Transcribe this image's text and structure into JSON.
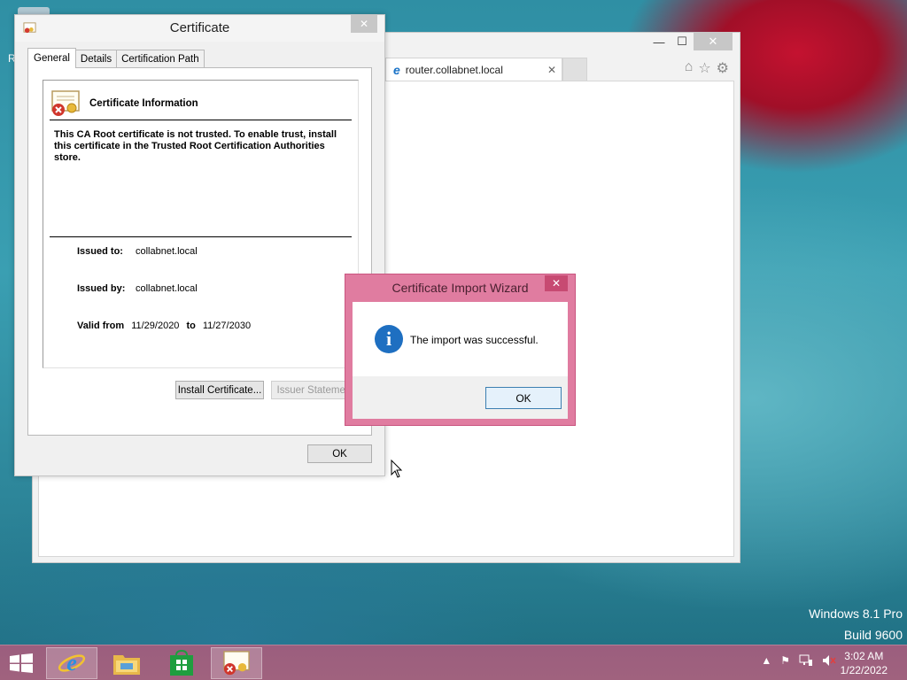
{
  "browser": {
    "tab_title": "router.collabnet.local",
    "tab_close": "✕",
    "icons": [
      "home-icon",
      "favorites-star-icon",
      "settings-gear-icon"
    ],
    "caption_min": "—",
    "caption_max": "☐",
    "caption_close": "✕"
  },
  "certificate_dialog": {
    "title": "Certificate",
    "close_glyph": "✕",
    "tabs": [
      "General",
      "Details",
      "Certification Path"
    ],
    "active_tab": "General",
    "heading": "Certificate Information",
    "warning": "This CA Root certificate is not trusted. To enable trust, install this certificate in the Trusted Root Certification Authorities store.",
    "issued_to_label": "Issued to:",
    "issued_to": "collabnet.local",
    "issued_by_label": "Issued by:",
    "issued_by": "collabnet.local",
    "valid_from_label": "Valid from",
    "valid_from": "11/29/2020",
    "to_label": "to",
    "valid_to": "11/27/2030",
    "install_button": "Install Certificate...",
    "issuer_statement_button": "Issuer Statement",
    "ok_button": "OK"
  },
  "wizard": {
    "title": "Certificate Import Wizard",
    "close_glyph": "✕",
    "message": "The import was successful.",
    "ok_button": "OK",
    "icon": "info-icon"
  },
  "desktop": {
    "edge_letter": "R",
    "watermark_line1": "Windows 8.1 Pro",
    "watermark_line2": "Build 9600"
  },
  "taskbar": {
    "items": [
      "internet-explorer",
      "file-explorer",
      "store",
      "certificate"
    ],
    "active_item": "internet-explorer",
    "clock_time": "3:02 AM",
    "clock_date": "1/22/2022"
  },
  "colors": {
    "wizard_frame": "#e07ca0",
    "taskbar": "#9b5e7e",
    "info_blue": "#1e6fc1"
  }
}
